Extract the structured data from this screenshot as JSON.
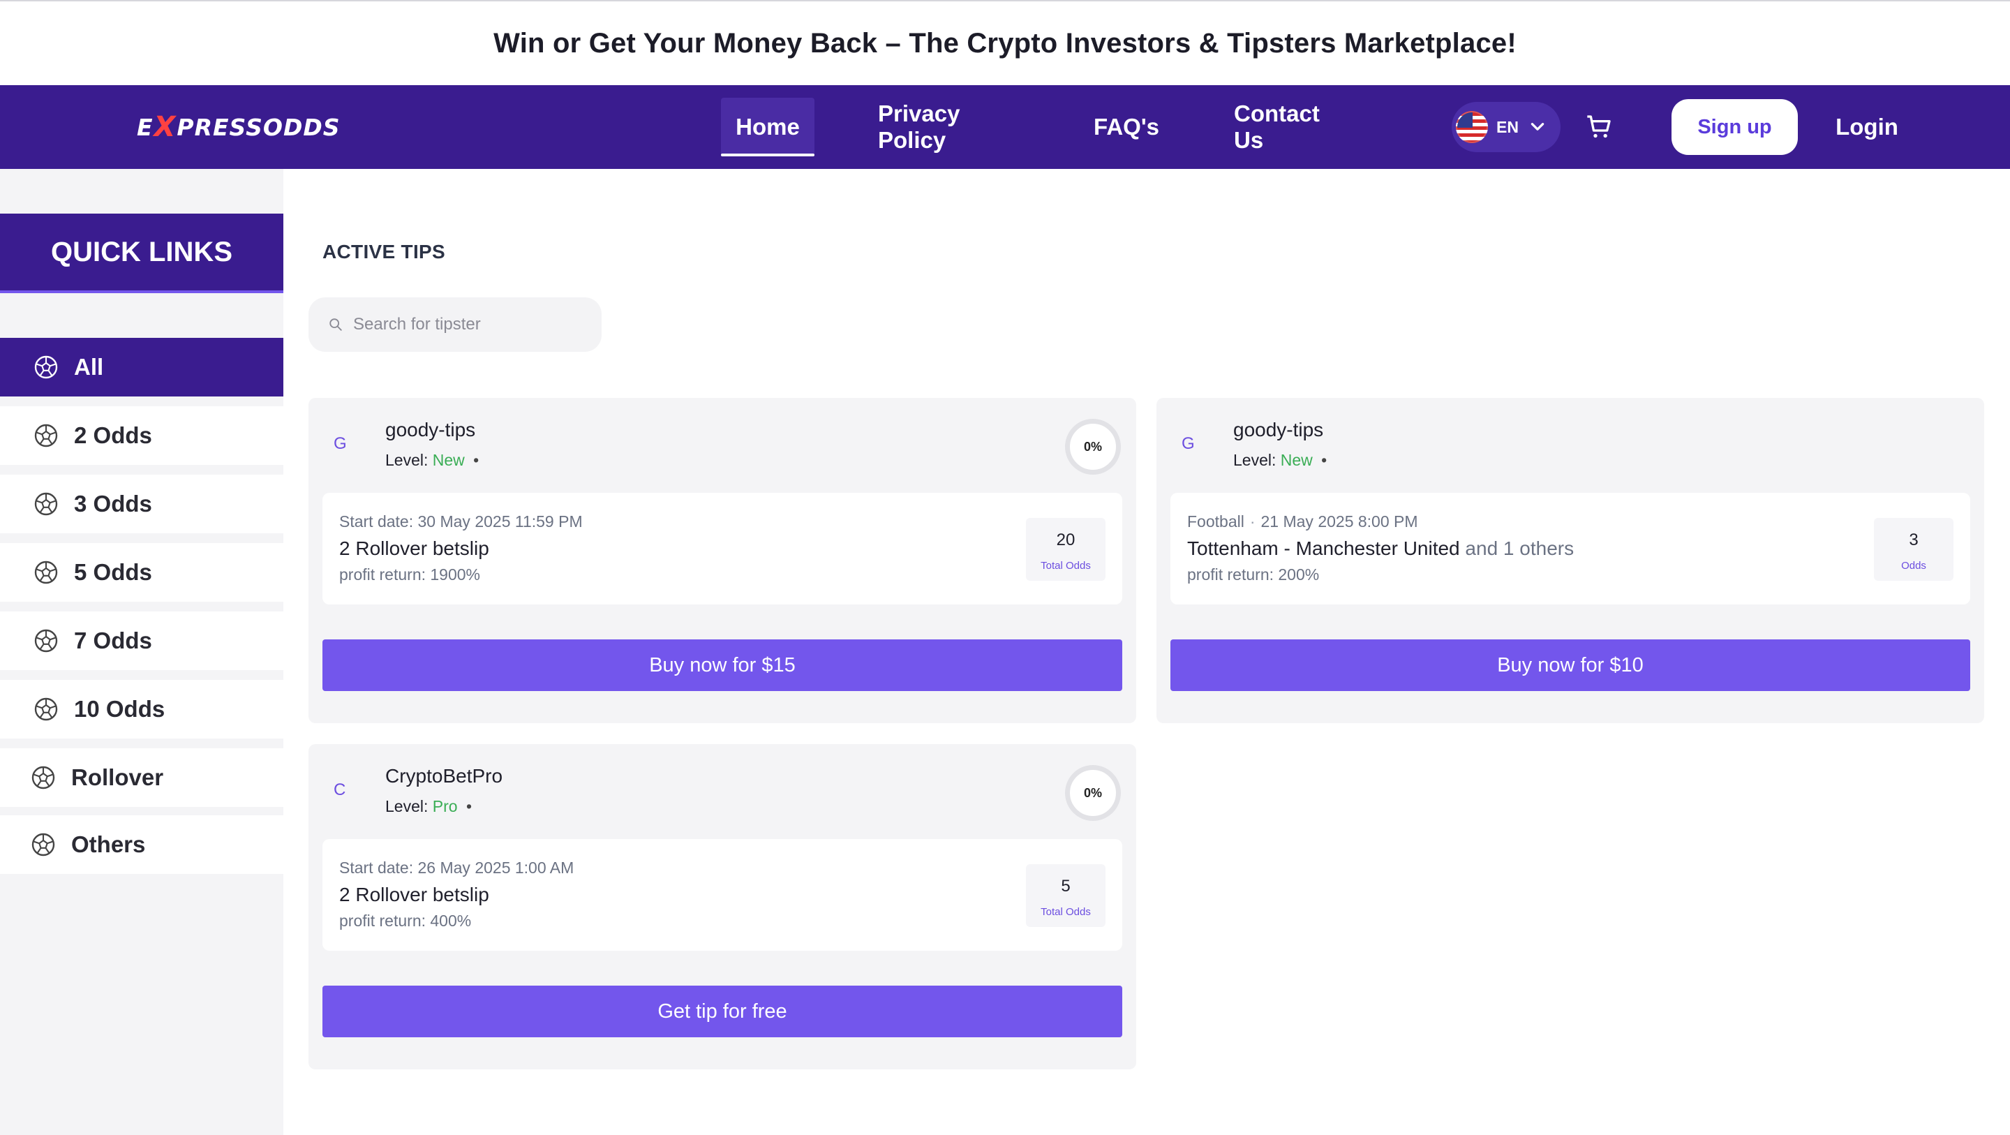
{
  "announcement": "Win or Get Your Money Back – The Crypto Investors & Tipsters Marketplace!",
  "brand": {
    "logo_pre": "E",
    "logo_x": "X",
    "logo_post": "PRESSODDS"
  },
  "nav": {
    "items": [
      "Home",
      "Privacy Policy",
      "FAQ's",
      "Contact Us"
    ],
    "active": "Home",
    "language": "EN",
    "signup": "Sign up",
    "login": "Login"
  },
  "sidebar": {
    "title": "QUICK LINKS",
    "items": [
      "All",
      "2 Odds",
      "3 Odds",
      "5 Odds",
      "7 Odds",
      "10 Odds",
      "Rollover",
      "Others"
    ],
    "active": "All"
  },
  "main": {
    "title": "ACTIVE TIPS",
    "search_placeholder": "Search for tipster",
    "tips": [
      {
        "initial": "G",
        "tipster": "goody-tips",
        "level_label": "Level:",
        "level": "New",
        "dot": "•",
        "win_rate": "0%",
        "meta": "Start date: 30 May 2025 11:59 PM",
        "title": "2 Rollover betslip",
        "profit": "profit return: 1900%",
        "odds_value": "20",
        "odds_label": "Total Odds",
        "button": "Buy now for $15"
      },
      {
        "initial": "G",
        "tipster": "goody-tips",
        "level_label": "Level:",
        "level": "New",
        "dot": "•",
        "sport": "Football",
        "meta_sep": "·",
        "meta": "21 May 2025 8:00 PM",
        "title": "Tottenham - Manchester United",
        "others": "and 1 others",
        "profit": "profit return: 200%",
        "odds_value": "3",
        "odds_label": "Odds",
        "button": "Buy now for $10"
      },
      {
        "initial": "C",
        "tipster": "CryptoBetPro",
        "level_label": "Level:",
        "level": "Pro",
        "dot": "•",
        "win_rate": "0%",
        "meta": "Start date: 26 May 2025 1:00 AM",
        "title": "2 Rollover betslip",
        "profit": "profit return: 400%",
        "odds_value": "5",
        "odds_label": "Total Odds",
        "button": "Get tip for free"
      }
    ]
  },
  "colors": {
    "nav_bg": "#3a1c8f",
    "accent": "#7356ec",
    "level_green": "#3aad55",
    "card_bg": "#f4f4f6"
  },
  "icons": {
    "search": "search-icon",
    "cart": "cart-icon",
    "chevron": "chevron-down-icon",
    "flag": "us-flag-icon",
    "category": "soccer-ball-icon"
  }
}
